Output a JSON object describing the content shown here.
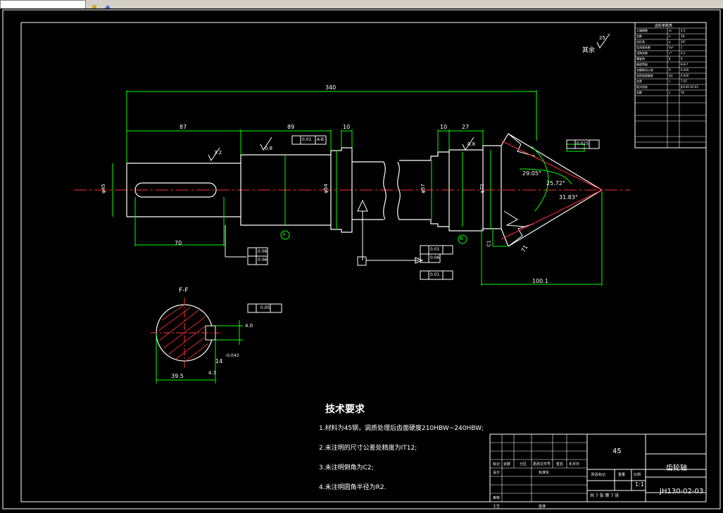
{
  "app": {
    "toolbar_icons": [
      "tool-icon-1",
      "tool-icon-2"
    ]
  },
  "drawing": {
    "roughness_other": "其余",
    "roughness_other_value": "25",
    "dims": {
      "total_length": "340",
      "len_87": "87",
      "len_89": "89",
      "len_10a": "10",
      "len_10b": "10",
      "len_27": "27",
      "len_70": "70",
      "len_71": "71",
      "len_100": "100.1",
      "d_key": "φ45",
      "d_phi": "φ54",
      "d_phi57": "φ57",
      "d_phi72": "φ72",
      "rough_32": "3.2",
      "rough_08a": "0.8",
      "rough_08b": "0.8",
      "rough_08c": "0.8",
      "angle_2905": "29.05°",
      "angle_2572": "25.72°",
      "angle_3183": "31.83°",
      "tol_001a": "0.01",
      "tol_001b": "0.01",
      "tol_001c": "0.01",
      "tol_0025": "0.025",
      "tol_006a": "0.06",
      "tol_006b": "0.06",
      "tol_006c": "0.06",
      "datum_a": "A",
      "datum_b": "B",
      "datum_ab": "A-B",
      "section_label": "F-F",
      "section_40": "4.0",
      "section_14": "14",
      "section_395": "39.5",
      "section_43": "4.3",
      "section_tol": "-0.043",
      "section_sym": "0.05",
      "chamfer": "C1"
    },
    "tech": {
      "title": "技术要求",
      "items": [
        "1.材料为45钢，调质处理后齿面硬度210HBW~240HBW;",
        "2.未注明的尺寸公差处精度为IT12;",
        "3.未注明倒角为C2;",
        "4.未注明圆角半径为R2."
      ]
    },
    "titleblock": {
      "material": "45",
      "part_name": "齿轮轴",
      "scale": "1:1",
      "drawing_no": "JH130-02-03",
      "sheet_info": "共 7 张    第 7 张",
      "labels": [
        "标记",
        "处数",
        "分区",
        "更改文件号",
        "签名",
        "年月日",
        "设计",
        "标准化",
        "审核",
        "工艺",
        "批准",
        "阶段标记",
        "重量",
        "比例"
      ]
    },
    "gear_table": {
      "title": "齿轮参数表",
      "rows": [
        [
          "大端模数",
          "m",
          "4.5"
        ],
        [
          "齿数",
          "z",
          "18"
        ],
        [
          "齿形角",
          "α",
          "20°"
        ],
        [
          "齿顶高系数",
          "ha*",
          "1"
        ],
        [
          "顶隙系数",
          "c*",
          "0.2"
        ],
        [
          "螺旋角",
          "β",
          "0"
        ],
        [
          "精度等级",
          "",
          "8-8-7"
        ],
        [
          "齿圈跳动公差",
          "Fr",
          "0.045"
        ],
        [
          "齿距极限偏差",
          "fpt",
          "0.020"
        ],
        [
          "齿厚",
          "s",
          "7.07"
        ],
        [
          "配对齿轮",
          "",
          "JH130-02-02"
        ],
        [
          "齿数",
          "z",
          "56"
        ]
      ]
    }
  }
}
